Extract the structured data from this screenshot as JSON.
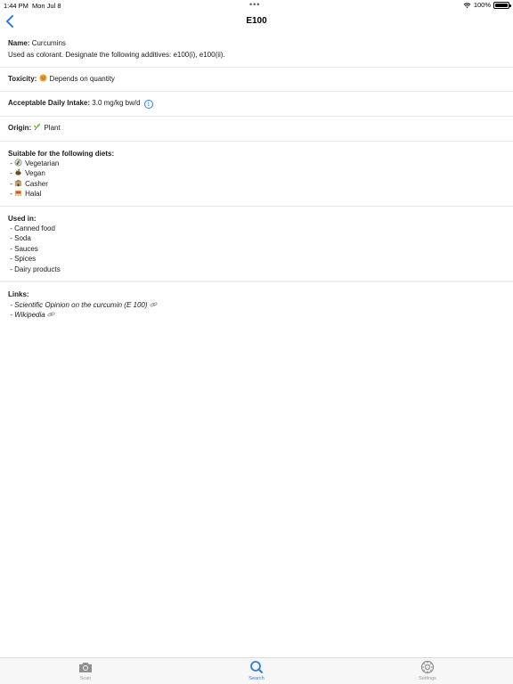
{
  "status_bar": {
    "time": "1:44 PM",
    "date": "Mon Jul 8",
    "dots": "•••",
    "battery": "100%"
  },
  "nav": {
    "title": "E100"
  },
  "name_section": {
    "label": "Name:",
    "value": "Curcumins",
    "description": "Used as colorant. Designate the following additives: e100(i), e100(ii)."
  },
  "toxicity": {
    "label": "Toxicity:",
    "value": "Depends on quantity"
  },
  "adi": {
    "label": "Acceptable Daily Intake:",
    "value": "3.0 mg/kg bw/d"
  },
  "origin": {
    "label": "Origin:",
    "value": "Plant"
  },
  "diets": {
    "label": "Suitable for the following diets:",
    "items": [
      "Vegetarian",
      "Vegan",
      "Casher",
      "Halal"
    ]
  },
  "used_in": {
    "label": "Used in:",
    "items": [
      "Canned food",
      "Soda",
      "Sauces",
      "Spices",
      "Dairy products"
    ]
  },
  "links": {
    "label": "Links:",
    "items": [
      "Scientific Opinion on the curcumin (E 100)",
      "Wikipedia"
    ]
  },
  "list_prefix": "- ",
  "tabs": [
    {
      "label": "Scan",
      "icon": "camera-icon"
    },
    {
      "label": "Search",
      "icon": "search-icon"
    },
    {
      "label": "Settings",
      "icon": "gear-icon"
    }
  ],
  "colors": {
    "accent": "#2f7ce6",
    "toxicity_dot": "#f0a030"
  }
}
